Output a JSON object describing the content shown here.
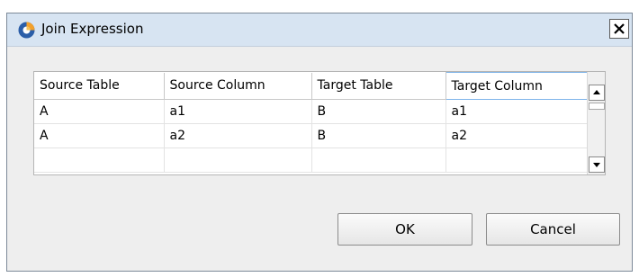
{
  "window": {
    "title": "Join Expression",
    "app_icon": "eclipse-icon"
  },
  "table": {
    "columns": [
      "Source Table",
      "Source Column",
      "Target Table",
      "Target Column"
    ],
    "rows": [
      [
        "A",
        "a1",
        "B",
        "a1"
      ],
      [
        "A",
        "a2",
        "B",
        "a2"
      ],
      [
        "",
        "",
        "",
        ""
      ]
    ]
  },
  "buttons": {
    "ok_label": "OK",
    "cancel_label": "Cancel"
  },
  "colors": {
    "titlebar": "#d7e4f2",
    "window_bg": "#eeeeee"
  }
}
